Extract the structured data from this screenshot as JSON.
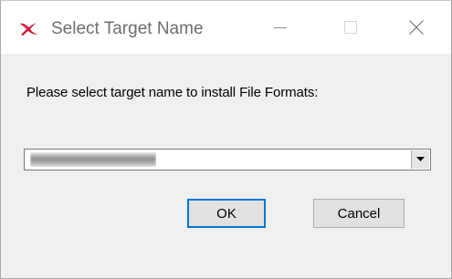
{
  "window": {
    "title": "Select Target Name",
    "app_icon": "adobe-acrobat-icon",
    "caption_buttons": {
      "minimize_icon": "minimize-icon",
      "maximize_icon": "maximize-icon",
      "close_icon": "close-icon"
    }
  },
  "dialog": {
    "prompt": "Please select target name to install File Formats:",
    "target_combo": {
      "selected_value": "",
      "value_obscured": true,
      "arrow_icon": "dropdown-arrow-icon"
    },
    "ok_label": "OK",
    "cancel_label": "Cancel"
  },
  "colors": {
    "title_text": "#6e6e6e",
    "client_background": "#f0f0f0",
    "default_button_border": "#0078d7",
    "app_icon_red": "#c8102e"
  }
}
